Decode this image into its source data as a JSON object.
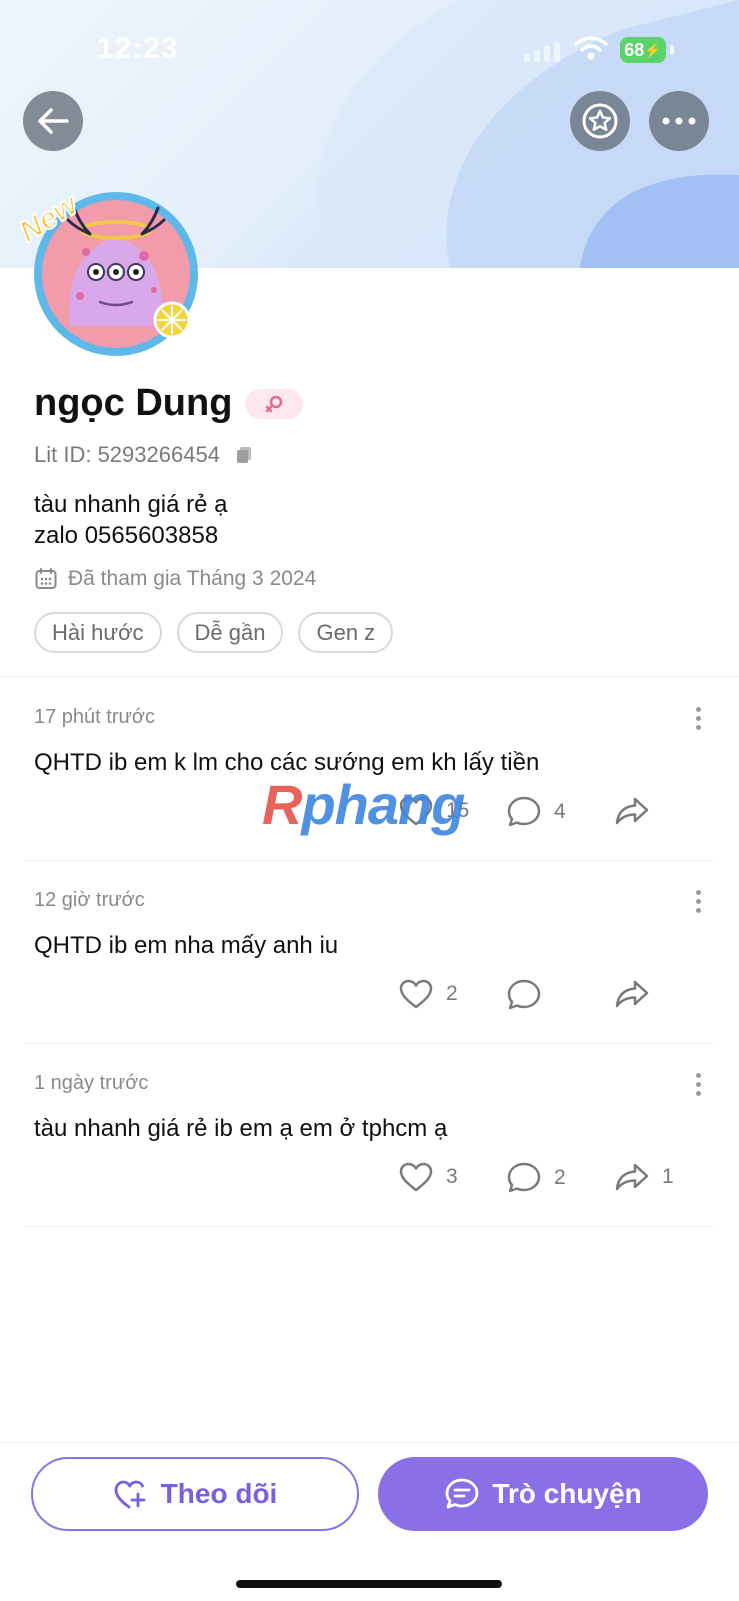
{
  "status_bar": {
    "time": "12:23",
    "battery": "68"
  },
  "profile": {
    "name": "ngọc Dung",
    "new_badge": "New",
    "lit_id": "Lit ID: 5293266454",
    "bio_line1": "tàu nhanh giá rẻ ạ",
    "bio_line2": "zalo 0565603858",
    "joined": "Đã tham gia Tháng 3 2024",
    "tags": [
      "Hài hước",
      "Dễ gần",
      "Gen z"
    ]
  },
  "posts": [
    {
      "time": "17 phút trước",
      "text": "QHTD ib em k lm cho các sướng em kh lấy tiền",
      "likes": "15",
      "comments": "4",
      "shares": ""
    },
    {
      "time": "12 giờ trước",
      "text": "QHTD ib em nha mấy anh iu",
      "likes": "2",
      "comments": "",
      "shares": ""
    },
    {
      "time": "1 ngày trước",
      "text": "tàu nhanh giá rẻ ib em ạ em ở tphcm ạ",
      "likes": "3",
      "comments": "2",
      "shares": "1"
    }
  ],
  "watermark": {
    "first": "R",
    "rest": "phang"
  },
  "actions": {
    "follow": "Theo dõi",
    "chat": "Trò chuyện"
  },
  "colors": {
    "accent": "#8b6fe6",
    "battery": "#5bd36b",
    "gender": "#e86a8f"
  }
}
